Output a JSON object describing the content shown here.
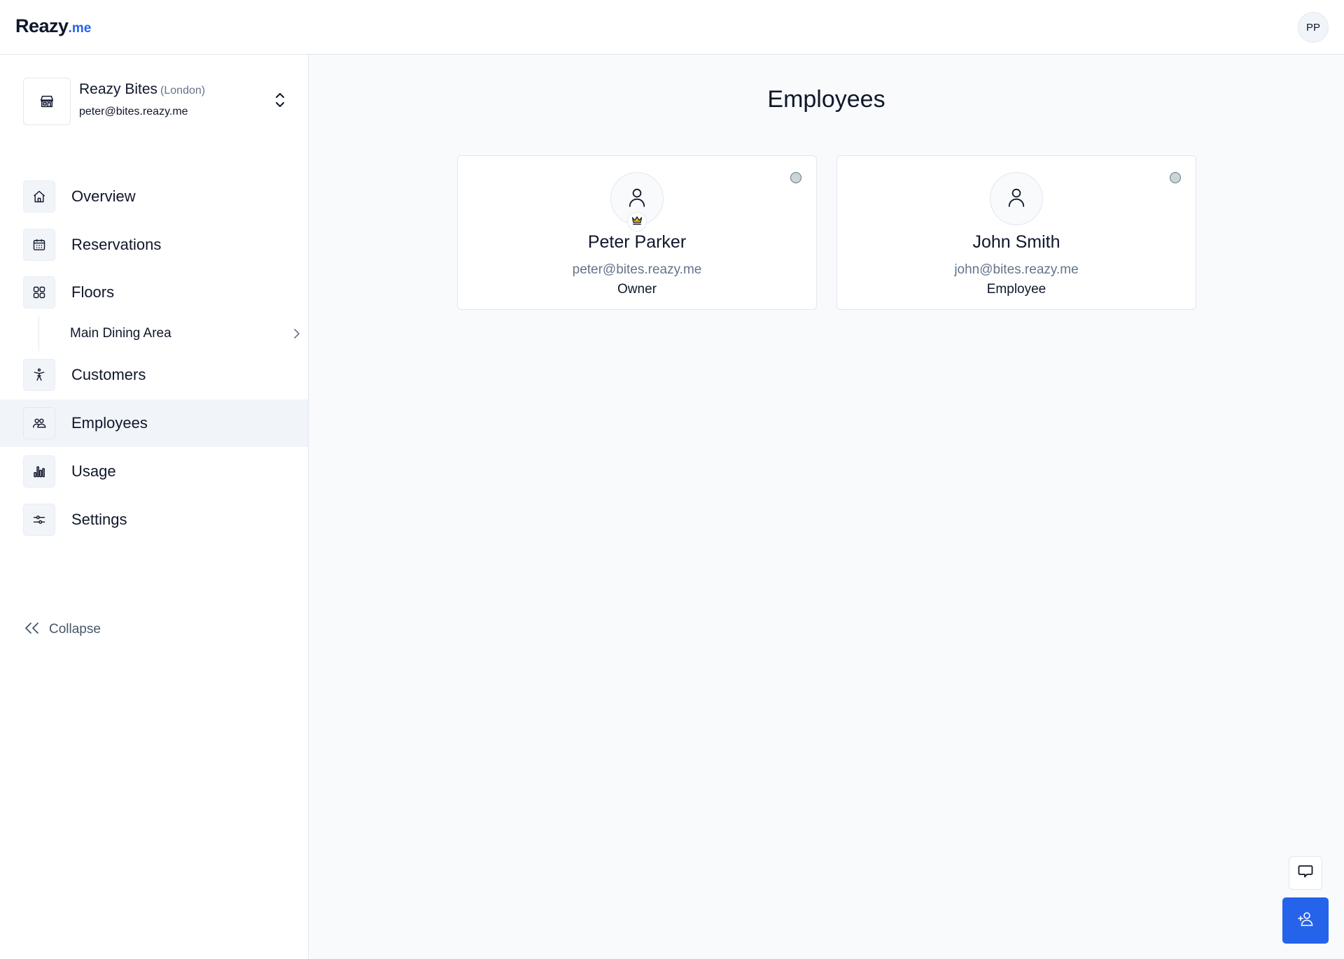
{
  "header": {
    "logo_main": "Reazy",
    "logo_tld": ".me",
    "user_initials": "PP"
  },
  "org": {
    "name": "Reazy Bites",
    "city": "(London)",
    "email": "peter@bites.reazy.me",
    "icon": "store-icon"
  },
  "sidebar": {
    "items": [
      {
        "label": "Overview",
        "icon": "home-icon",
        "active": false
      },
      {
        "label": "Reservations",
        "icon": "calendar-icon",
        "active": false
      },
      {
        "label": "Floors",
        "icon": "grid-icon",
        "active": false
      },
      {
        "label": "Customers",
        "icon": "accessibility-icon",
        "active": false
      },
      {
        "label": "Employees",
        "icon": "users-icon",
        "active": true
      },
      {
        "label": "Usage",
        "icon": "bar-chart-icon",
        "active": false
      },
      {
        "label": "Settings",
        "icon": "sliders-icon",
        "active": false
      }
    ],
    "sub_items": [
      {
        "label": "Main Dining Area",
        "parent": "Floors"
      }
    ],
    "collapse_label": "Collapse"
  },
  "main": {
    "title": "Employees",
    "employees": [
      {
        "name": "Peter Parker",
        "email": "peter@bites.reazy.me",
        "role": "Owner",
        "is_owner": true,
        "status": "offline"
      },
      {
        "name": "John Smith",
        "email": "john@bites.reazy.me",
        "role": "Employee",
        "is_owner": false,
        "status": "offline"
      }
    ]
  },
  "colors": {
    "accent": "#2563eb",
    "text": "#0f172a",
    "muted": "#64748b",
    "crown": "#eab308",
    "status_offline": "#cbd5d5"
  },
  "actions": {
    "chat": "chat-icon",
    "add_employee": "add-user-icon"
  }
}
